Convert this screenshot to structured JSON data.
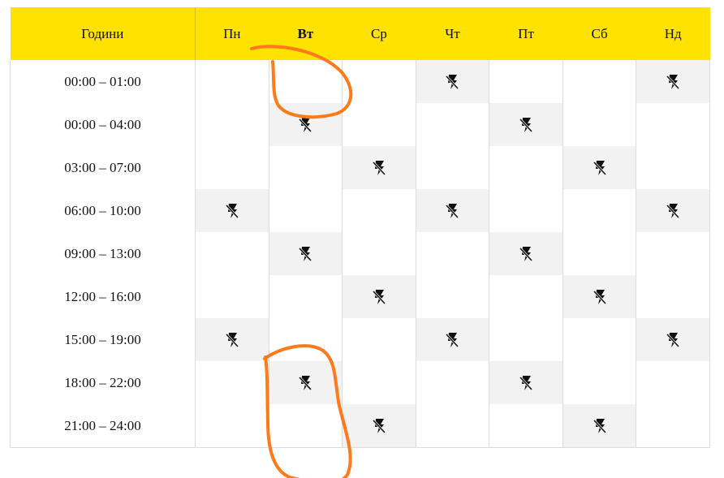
{
  "colors": {
    "header_bg": "#ffe200",
    "outage_cell_bg": "#f2f2f2",
    "annotation": "#ff7a1a"
  },
  "table": {
    "columns": [
      "Години",
      "Пн",
      "Вт",
      "Ср",
      "Чт",
      "Пт",
      "Сб",
      "Нд"
    ],
    "highlighted_column": "Вт",
    "outage_icon": "power-off-bolt-icon",
    "rows": [
      {
        "time": "00:00 – 01:00",
        "outages": [
          false,
          false,
          false,
          true,
          false,
          false,
          true
        ]
      },
      {
        "time": "00:00 – 04:00",
        "outages": [
          false,
          true,
          false,
          false,
          true,
          false,
          false
        ]
      },
      {
        "time": "03:00 – 07:00",
        "outages": [
          false,
          false,
          true,
          false,
          false,
          true,
          false
        ]
      },
      {
        "time": "06:00 – 10:00",
        "outages": [
          true,
          false,
          false,
          true,
          false,
          false,
          true
        ]
      },
      {
        "time": "09:00 – 13:00",
        "outages": [
          false,
          true,
          false,
          false,
          true,
          false,
          false
        ]
      },
      {
        "time": "12:00 – 16:00",
        "outages": [
          false,
          false,
          true,
          false,
          false,
          true,
          false
        ]
      },
      {
        "time": "15:00 – 19:00",
        "outages": [
          true,
          false,
          false,
          true,
          false,
          false,
          true
        ]
      },
      {
        "time": "18:00 – 22:00",
        "outages": [
          false,
          true,
          false,
          false,
          true,
          false,
          false
        ]
      },
      {
        "time": "21:00 – 24:00",
        "outages": [
          false,
          false,
          true,
          false,
          false,
          true,
          false
        ]
      }
    ]
  }
}
